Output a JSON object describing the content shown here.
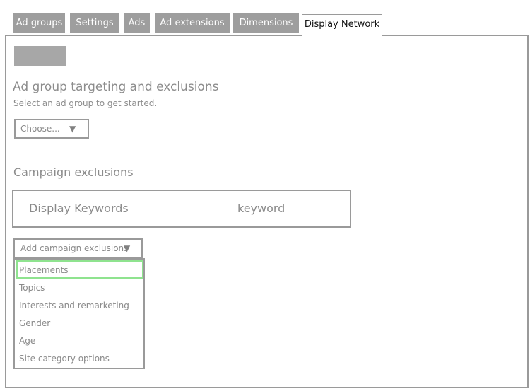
{
  "tabs": [
    {
      "label": "Ad groups"
    },
    {
      "label": "Settings"
    },
    {
      "label": "Ads"
    },
    {
      "label": "Ad extensions"
    },
    {
      "label": "Dimensions"
    },
    {
      "label": "Display Network",
      "active": true
    }
  ],
  "targeting": {
    "title": "Ad group targeting and exclusions",
    "subtitle": "Select an ad group to get started.",
    "select_value": "Choose..."
  },
  "campaign_exclusions": {
    "title": "Campaign exclusions",
    "row": {
      "col1": "Display Keywords",
      "col2": "keyword"
    },
    "dropdown_label": "Add campaign exclusions",
    "menu_items": [
      {
        "label": "Placements",
        "highlighted": true
      },
      {
        "label": "Topics"
      },
      {
        "label": "Interests and remarketing"
      },
      {
        "label": "Gender"
      },
      {
        "label": "Age"
      },
      {
        "label": "Site category options"
      }
    ]
  },
  "colors": {
    "tab_bg": "#9e9e9e",
    "highlight": "#8fe38f",
    "border": "#9a9a9a"
  },
  "icons": {
    "dropdown": "triangle-down-icon"
  }
}
